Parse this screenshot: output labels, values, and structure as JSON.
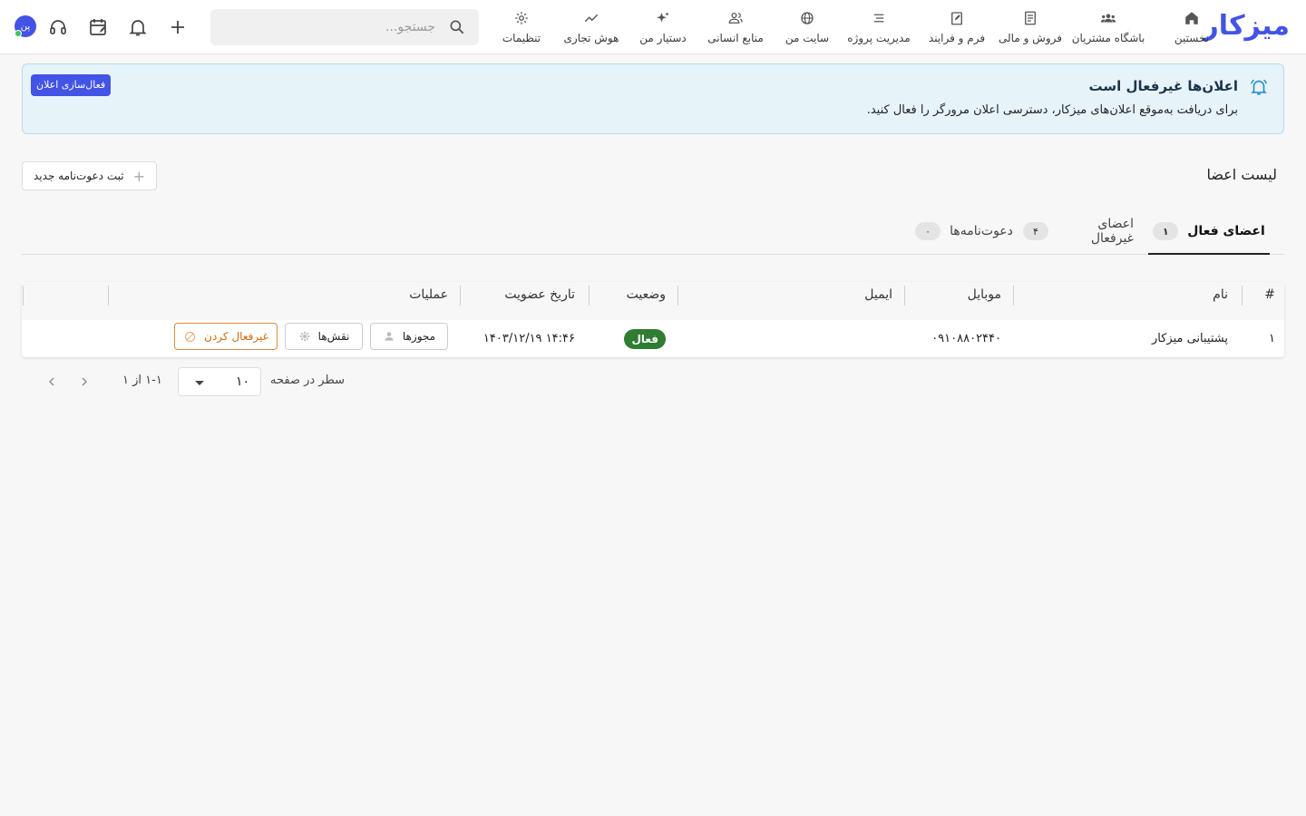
{
  "app": {
    "logo": "میزکار"
  },
  "nav": [
    {
      "id": "home",
      "label": "نخستین",
      "icon": "home-icon"
    },
    {
      "id": "customers",
      "label": "باشگاه مشتریان",
      "icon": "people-icon"
    },
    {
      "id": "sales",
      "label": "فروش و مالی",
      "icon": "receipt-icon"
    },
    {
      "id": "forms",
      "label": "فرم و فرایند",
      "icon": "edit-note-icon"
    },
    {
      "id": "projects",
      "label": "مدیریت پروژه",
      "icon": "list-icon"
    },
    {
      "id": "site",
      "label": "سایت من",
      "icon": "globe-icon"
    },
    {
      "id": "hr",
      "label": "منابع انسانی",
      "icon": "person-group-icon"
    },
    {
      "id": "assistant",
      "label": "دستیار من",
      "icon": "sparkle-icon"
    },
    {
      "id": "bi",
      "label": "هوش تجاری",
      "icon": "trend-icon"
    },
    {
      "id": "settings",
      "label": "تنظیمات",
      "icon": "gear-icon"
    }
  ],
  "search": {
    "placeholder": "جستجو..."
  },
  "avatar": {
    "initials": "پن"
  },
  "banner": {
    "title": "اعلان‌ها غیرفعال است",
    "description": "برای دریافت به‌موقع اعلان‌های میزکار، دسترسی اعلان مرورگر را فعال کنید.",
    "button": "فعال‌سازی اعلان"
  },
  "page": {
    "title": "لیست اعضا",
    "invite_button": "ثبت دعوت‌نامه جدید"
  },
  "tabs": [
    {
      "label": "اعضای فعال",
      "count": "۱",
      "active": true
    },
    {
      "label": "اعضای غیرفعال",
      "count": "۴",
      "active": false
    },
    {
      "label": "دعوت‌نامه‌ها",
      "count": "۰",
      "active": false
    }
  ],
  "table": {
    "headers": {
      "index": "#",
      "name": "نام",
      "mobile": "موبایل",
      "email": "ایمیل",
      "status": "وضعیت",
      "joined": "تاریخ عضویت",
      "actions": "عملیات"
    },
    "rows": [
      {
        "index": "۱",
        "name": "پشتیبانی میزکار",
        "mobile": "۰۹۱۰۸۸۰۲۴۴۰",
        "email": "",
        "status": "فعال",
        "joined": "۱۴:۴۶ ۱۴۰۳/۱۲/۱۹",
        "permissions_label": "مجوزها",
        "roles_label": "نقش‌ها",
        "deactivate_label": "غیرفعال کردن"
      }
    ]
  },
  "pagination": {
    "rows_per_page_label": "سطر در صفحه",
    "rows_per_page": "۱۰",
    "range": "۱-۱ از ۱"
  },
  "colors": {
    "brand": "#4353e6",
    "status_active": "#2e7d32",
    "danger": "#d66a12",
    "banner_bg": "#e6f3f9"
  }
}
